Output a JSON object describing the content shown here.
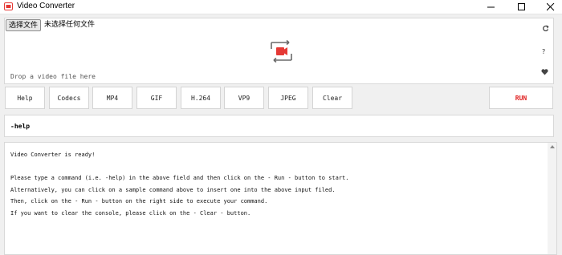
{
  "window": {
    "title": "Video Converter",
    "brand_color": "#e53935"
  },
  "dropzone": {
    "file_button_label": "选择文件",
    "file_status": "未选择任何文件",
    "hint": "Drop a video file here",
    "icons": [
      "convert-icon",
      "refresh-icon",
      "help-icon",
      "heart-icon"
    ],
    "help_glyph": "?"
  },
  "commands": {
    "help": "Help",
    "codecs": "Codecs",
    "mp4": "MP4",
    "gif": "GIF",
    "h264": "H.264",
    "vp9": "VP9",
    "jpeg": "JPEG",
    "clear": "Clear",
    "run": "RUN",
    "run_color": "#e02020"
  },
  "input": {
    "value": "-help"
  },
  "console": {
    "text": "Video Converter is ready!\n\nPlease type a command (i.e. -help) in the above field and then click on the - Run - button to start.\nAlternatively, you can click on a sample command above to insert one into the above input filed.\nThen, click on the - Run - button on the right side to execute your command.\nIf you want to clear the console, please click on the - Clear - button."
  }
}
